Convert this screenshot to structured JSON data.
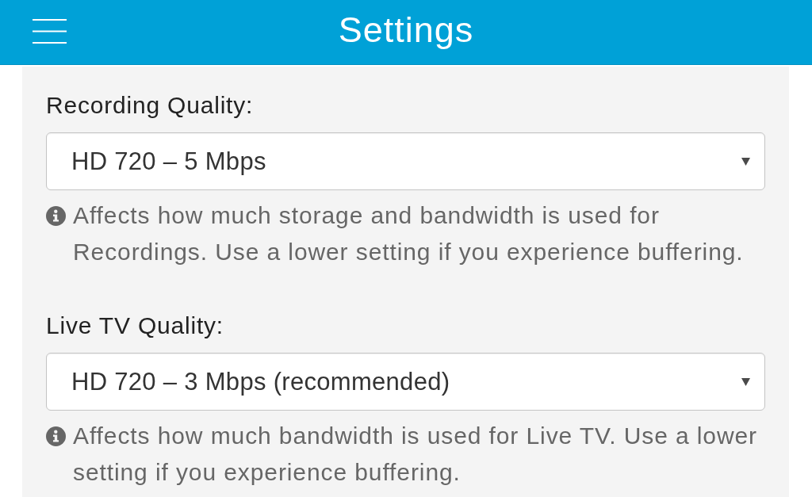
{
  "header": {
    "title": "Settings"
  },
  "settings": [
    {
      "label": "Recording Quality:",
      "value": "HD 720 – 5 Mbps",
      "help": "Affects how much storage and bandwidth is used for Recordings. Use a lower setting if you experience buffering."
    },
    {
      "label": "Live TV Quality:",
      "value": "HD 720 – 3 Mbps (recommended)",
      "help": "Affects how much bandwidth is used for Live TV. Use a lower setting if you experience buffering."
    }
  ]
}
